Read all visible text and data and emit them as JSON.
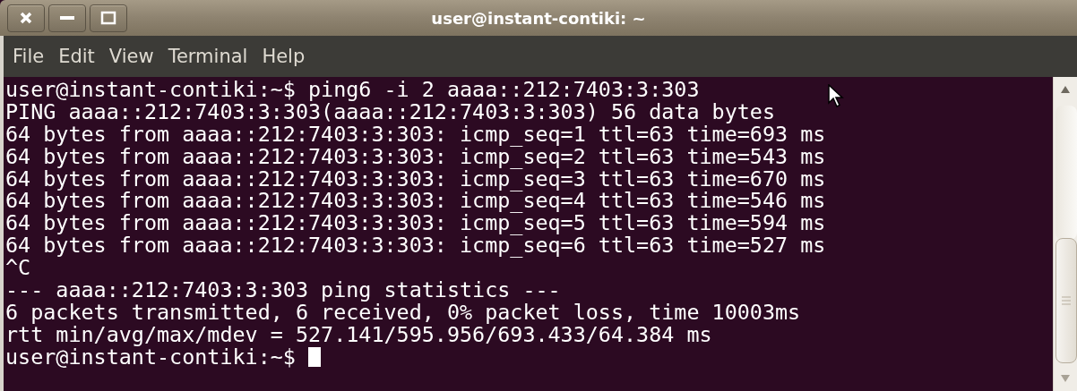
{
  "window": {
    "title": "user@instant-contiki: ~"
  },
  "menu": [
    "File",
    "Edit",
    "View",
    "Terminal",
    "Help"
  ],
  "terminal": {
    "lines": [
      "user@instant-contiki:~$ ping6 -i 2 aaaa::212:7403:3:303",
      "PING aaaa::212:7403:3:303(aaaa::212:7403:3:303) 56 data bytes",
      "64 bytes from aaaa::212:7403:3:303: icmp_seq=1 ttl=63 time=693 ms",
      "64 bytes from aaaa::212:7403:3:303: icmp_seq=2 ttl=63 time=543 ms",
      "64 bytes from aaaa::212:7403:3:303: icmp_seq=3 ttl=63 time=670 ms",
      "64 bytes from aaaa::212:7403:3:303: icmp_seq=4 ttl=63 time=546 ms",
      "64 bytes from aaaa::212:7403:3:303: icmp_seq=5 ttl=63 time=594 ms",
      "64 bytes from aaaa::212:7403:3:303: icmp_seq=6 ttl=63 time=527 ms",
      "^C",
      "--- aaaa::212:7403:3:303 ping statistics ---",
      "6 packets transmitted, 6 received, 0% packet loss, time 10003ms",
      "rtt min/avg/max/mdev = 527.141/595.956/693.433/64.384 ms",
      "user@instant-contiki:~$"
    ]
  }
}
